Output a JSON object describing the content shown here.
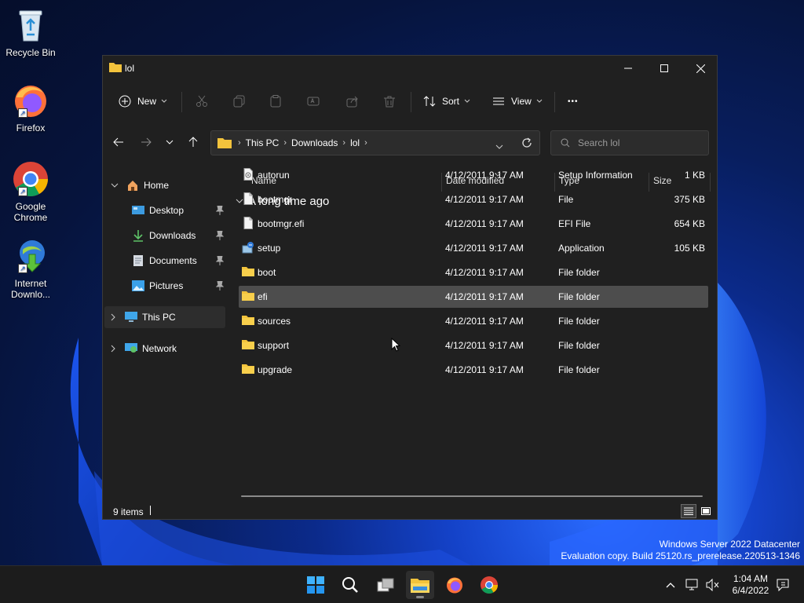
{
  "desktop": {
    "icons": [
      {
        "label": "Recycle Bin"
      },
      {
        "label": "Firefox"
      },
      {
        "label": "Google Chrome"
      },
      {
        "label": "Internet Downlo..."
      }
    ],
    "watermark_line1": "Windows Server 2022 Datacenter",
    "watermark_line2": "Evaluation copy. Build 25120.rs_prerelease.220513-1346"
  },
  "window": {
    "title": "lol",
    "toolbar": {
      "new_label": "New",
      "sort_label": "Sort",
      "view_label": "View",
      "more_label": "•••"
    },
    "address": {
      "crumbs": [
        "This PC",
        "Downloads",
        "lol"
      ]
    },
    "search": {
      "placeholder": "Search lol"
    },
    "nav": {
      "home": "Home",
      "quick": [
        "Desktop",
        "Downloads",
        "Documents",
        "Pictures"
      ],
      "this_pc": "This PC",
      "network": "Network"
    },
    "columns": {
      "name": "Name",
      "date": "Date modified",
      "type": "Type",
      "size": "Size"
    },
    "group_label": "A long time ago",
    "files": [
      {
        "name": "autorun",
        "date": "4/12/2011 9:17 AM",
        "type": "Setup Information",
        "size": "1 KB",
        "icon": "setup-info-icon"
      },
      {
        "name": "bootmgr",
        "date": "4/12/2011 9:17 AM",
        "type": "File",
        "size": "375 KB",
        "icon": "file-icon"
      },
      {
        "name": "bootmgr.efi",
        "date": "4/12/2011 9:17 AM",
        "type": "EFI File",
        "size": "654 KB",
        "icon": "file-icon"
      },
      {
        "name": "setup",
        "date": "4/12/2011 9:17 AM",
        "type": "Application",
        "size": "105 KB",
        "icon": "setup-app-icon"
      },
      {
        "name": "boot",
        "date": "4/12/2011 9:17 AM",
        "type": "File folder",
        "size": "",
        "icon": "folder-icon"
      },
      {
        "name": "efi",
        "date": "4/12/2011 9:17 AM",
        "type": "File folder",
        "size": "",
        "icon": "folder-icon"
      },
      {
        "name": "sources",
        "date": "4/12/2011 9:17 AM",
        "type": "File folder",
        "size": "",
        "icon": "folder-icon"
      },
      {
        "name": "support",
        "date": "4/12/2011 9:17 AM",
        "type": "File folder",
        "size": "",
        "icon": "folder-icon"
      },
      {
        "name": "upgrade",
        "date": "4/12/2011 9:17 AM",
        "type": "File folder",
        "size": "",
        "icon": "folder-icon"
      }
    ],
    "status": "9 items"
  },
  "taskbar": {
    "time": "1:04 AM",
    "date": "6/4/2022"
  },
  "colors": {
    "window_bg": "#202020",
    "folder": "#f3c33c",
    "accent": "#4cc2ff"
  }
}
